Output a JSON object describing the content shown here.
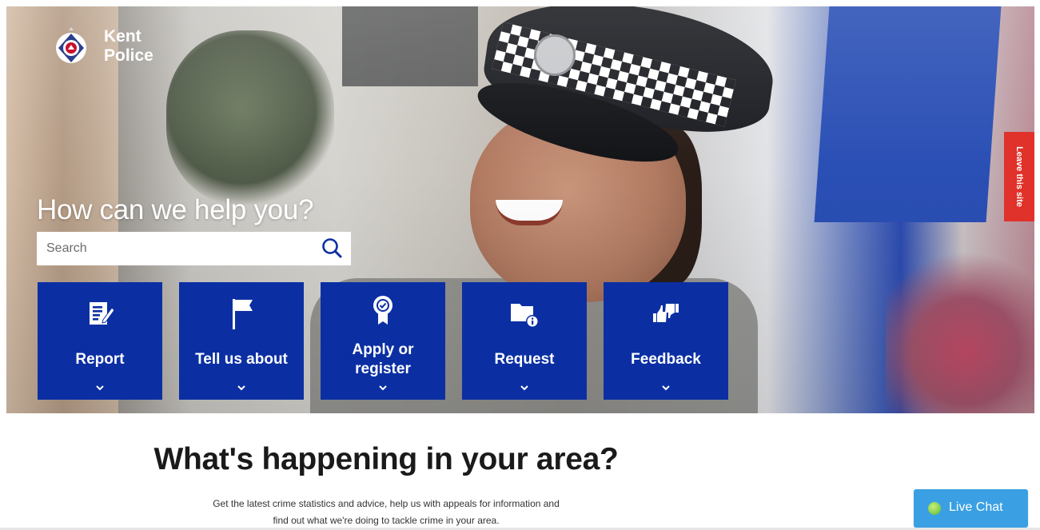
{
  "brand": {
    "name_line1": "Kent",
    "name_line2": "Police"
  },
  "leave_site": {
    "label": "Leave this site"
  },
  "hero": {
    "headline": "How can we help you?",
    "search": {
      "placeholder": "Search"
    }
  },
  "tiles": [
    {
      "label": "Report",
      "icon": "report-form-icon"
    },
    {
      "label": "Tell us about",
      "icon": "flag-icon"
    },
    {
      "label": "Apply or register",
      "icon": "award-rosette-icon"
    },
    {
      "label": "Request",
      "icon": "folder-info-icon"
    },
    {
      "label": "Feedback",
      "icon": "thumbs-up-down-icon"
    }
  ],
  "area": {
    "title": "What's happening in your area?",
    "description_line1": "Get the latest crime statistics and advice, help us with appeals for information and",
    "description_line2": "find out what we're doing to tackle crime in your area."
  },
  "live_chat": {
    "label": "Live Chat"
  },
  "colors": {
    "tile_blue": "#0b2fa3",
    "leave_red": "#e0312b",
    "live_chat_blue": "#3aa0e3"
  }
}
